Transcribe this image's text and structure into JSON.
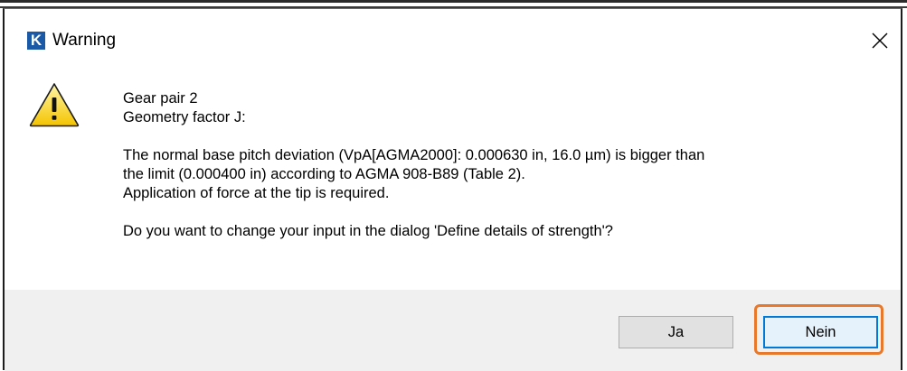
{
  "dialog": {
    "title": "Warning",
    "app_icon_letter": "K",
    "icons": {
      "app": "application-logo-icon",
      "close": "close-icon",
      "message": "warning-triangle-icon"
    },
    "message": {
      "line1": "Gear pair 2",
      "line2": "Geometry factor J:",
      "line3": "The normal base pitch deviation (VpA[AGMA2000]: 0.000630 in, 16.0 µm) is bigger than",
      "line4": "the limit (0.000400 in) according to AGMA 908-B89 (Table 2).",
      "line5": "Application of force at the tip is required.",
      "line6": "Do you want to change your input in the dialog 'Define details of strength'?"
    },
    "buttons": {
      "yes_label": "Ja",
      "no_label": "Nein"
    }
  },
  "colors": {
    "app_icon_bg": "#1b58a6",
    "footer_bg": "#f0f0f0",
    "default_button_border": "#0078d7",
    "highlight_outline": "#e8782a"
  }
}
